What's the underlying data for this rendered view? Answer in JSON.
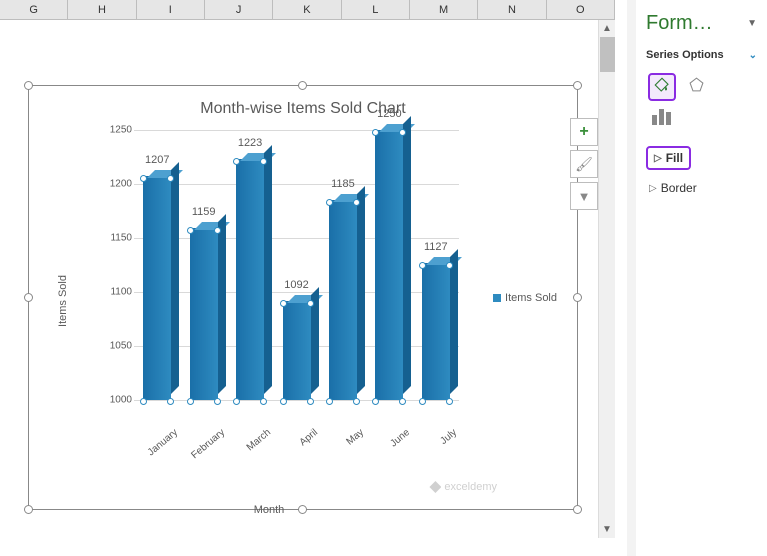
{
  "columns": [
    "G",
    "H",
    "I",
    "J",
    "K",
    "L",
    "M",
    "N",
    "O"
  ],
  "chart_data": {
    "type": "bar",
    "title": "Month-wise Items Sold Chart",
    "xlabel": "Month",
    "ylabel": "Items Sold",
    "ylim": [
      1000,
      1250
    ],
    "ystep": 50,
    "categories": [
      "January",
      "February",
      "March",
      "April",
      "May",
      "June",
      "July"
    ],
    "values": [
      1207,
      1159,
      1223,
      1092,
      1185,
      1250,
      1127
    ],
    "series_name": "Items Sold"
  },
  "watermark": "exceldemy",
  "pane": {
    "title": "Form…",
    "section": "Series Options",
    "fill": "Fill",
    "border": "Border"
  }
}
